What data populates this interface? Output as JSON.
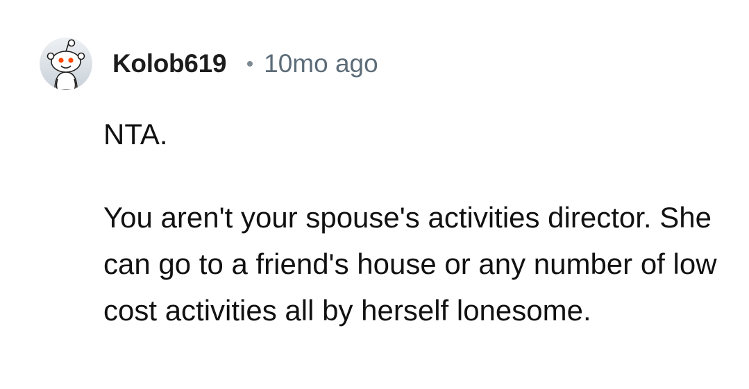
{
  "comment": {
    "author": "Kolob619",
    "separator": "•",
    "timestamp": "10mo ago",
    "avatar_icon": "reddit-snoo-avatar-icon",
    "paragraphs": [
      "NTA.",
      "You aren't your spouse's activities director. She can go to a friend's house or any number of low cost activities all by herself lonesome."
    ]
  },
  "colors": {
    "text": "#111111",
    "meta": "#5c6c78",
    "avatar_bg": "#d7dde3",
    "snoo_eye": "#ff4500"
  }
}
